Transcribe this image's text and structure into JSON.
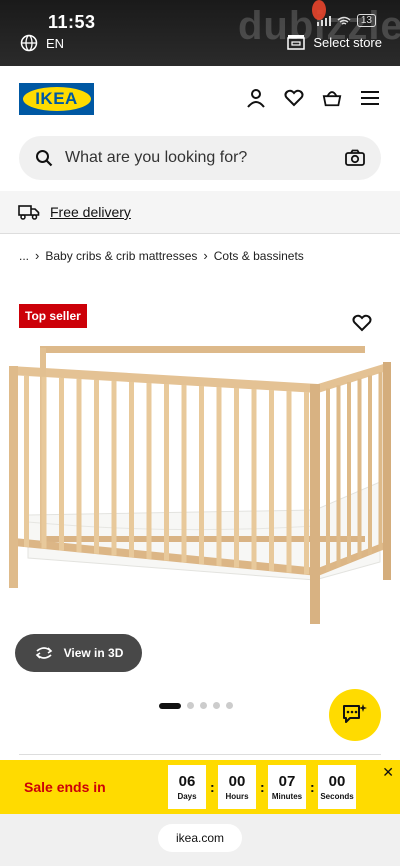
{
  "status": {
    "time": "11:53",
    "battery": "13"
  },
  "top_bar": {
    "language": "EN",
    "store_label": "Select store"
  },
  "watermark": "dubizzle",
  "header": {
    "logo_text": "IKEA"
  },
  "search": {
    "placeholder": "What are you looking for?"
  },
  "delivery": {
    "label": "Free delivery"
  },
  "breadcrumb": {
    "ellipsis": "...",
    "items": [
      "Baby cribs & crib mattresses",
      "Cots & bassinets"
    ]
  },
  "product": {
    "badge": "Top seller",
    "view3d_label": "View in 3D",
    "carousel_total": 5,
    "carousel_active": 1
  },
  "sale": {
    "label": "Sale ends in",
    "units": [
      {
        "value": "06",
        "label": "Days"
      },
      {
        "value": "00",
        "label": "Hours"
      },
      {
        "value": "07",
        "label": "Minutes"
      },
      {
        "value": "00",
        "label": "Seconds"
      }
    ]
  },
  "browser": {
    "url": "ikea.com"
  },
  "colors": {
    "ikea_blue": "#0058a3",
    "ikea_yellow": "#ffdb00",
    "badge_red": "#cc0008"
  }
}
